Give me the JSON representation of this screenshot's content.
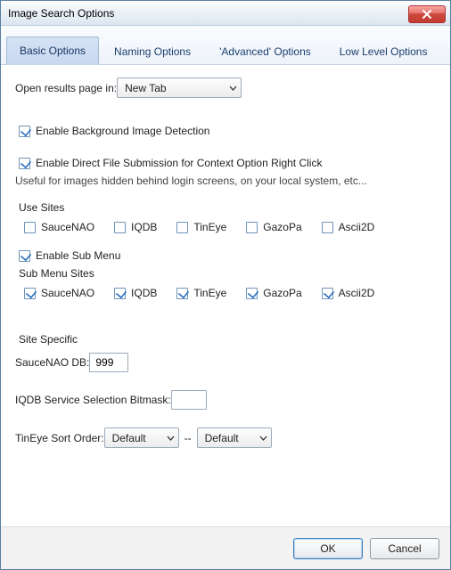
{
  "window": {
    "title": "Image Search Options"
  },
  "tabs": [
    {
      "label": "Basic Options",
      "active": true
    },
    {
      "label": "Naming Options",
      "active": false
    },
    {
      "label": "'Advanced' Options",
      "active": false
    },
    {
      "label": "Low Level Options",
      "active": false
    }
  ],
  "openResults": {
    "label": "Open results page in:",
    "value": "New Tab"
  },
  "bgDetect": {
    "checked": true,
    "label": "Enable Background Image Detection"
  },
  "directFile": {
    "checked": true,
    "label": "Enable Direct File Submission for Context Option Right Click",
    "helper": "Useful for images hidden behind login screens, on your local system, etc..."
  },
  "useSites": {
    "title": "Use Sites",
    "items": [
      {
        "label": "SauceNAO",
        "checked": false
      },
      {
        "label": "IQDB",
        "checked": false
      },
      {
        "label": "TinEye",
        "checked": false
      },
      {
        "label": "GazoPa",
        "checked": false
      },
      {
        "label": "Ascii2D",
        "checked": false
      }
    ]
  },
  "subMenu": {
    "enable": {
      "checked": true,
      "label": "Enable Sub Menu"
    },
    "title": "Sub Menu Sites",
    "items": [
      {
        "label": "SauceNAO",
        "checked": true
      },
      {
        "label": "IQDB",
        "checked": true
      },
      {
        "label": "TinEye",
        "checked": true
      },
      {
        "label": "GazoPa",
        "checked": true
      },
      {
        "label": "Ascii2D",
        "checked": true
      }
    ]
  },
  "siteSpecific": {
    "title": "Site Specific",
    "sauceDbLabel": "SauceNAO DB:",
    "sauceDbValue": "999",
    "iqdbLabel": "IQDB Service Selection Bitmask:",
    "iqdbValue": "",
    "tineyeLabel": "TinEye Sort Order:",
    "tineyeSort1": "Default",
    "tineyeSep": "--",
    "tineyeSort2": "Default"
  },
  "footer": {
    "ok": "OK",
    "cancel": "Cancel"
  }
}
